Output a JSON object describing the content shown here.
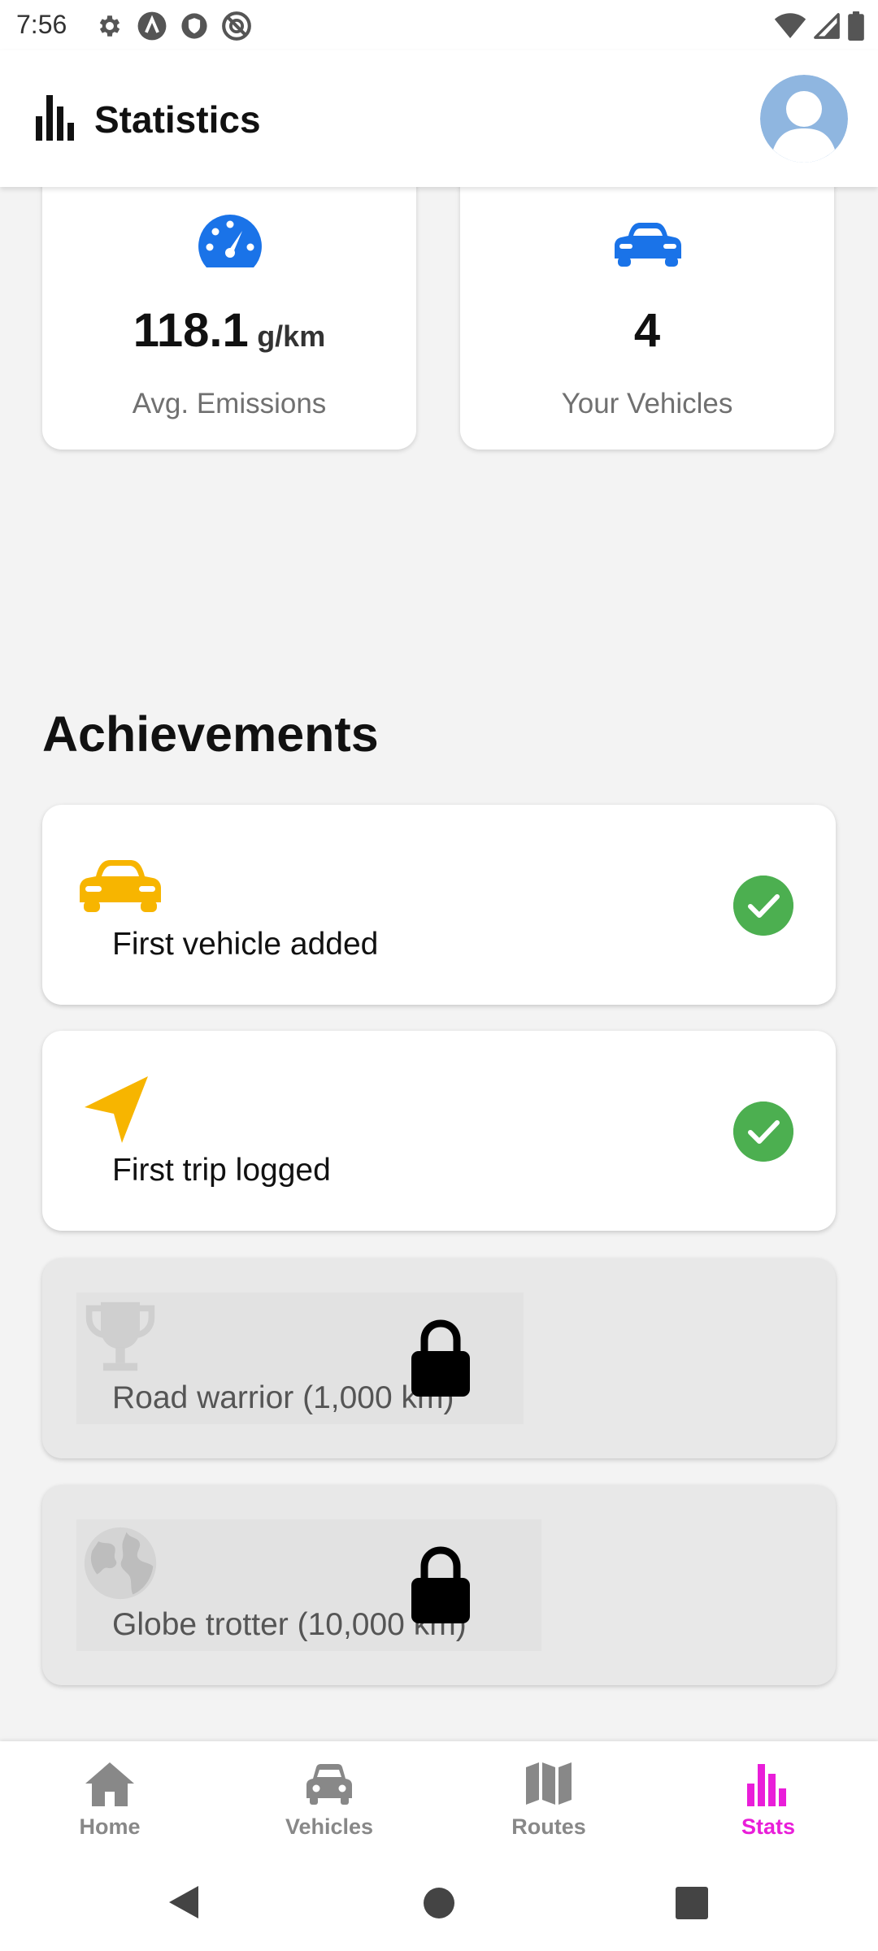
{
  "status_bar": {
    "time": "7:56"
  },
  "app_bar": {
    "title": "Statistics"
  },
  "stats": [
    {
      "value": "118.1",
      "unit": "g/km",
      "label": "Avg. Emissions",
      "icon": "speedometer-icon",
      "color": "#1a73e8"
    },
    {
      "value": "4",
      "label": "Your Vehicles",
      "icon": "car-icon",
      "color": "#1a73e8"
    }
  ],
  "achievements": {
    "title": "Achievements",
    "items": [
      {
        "label": "First vehicle added",
        "icon": "car-icon",
        "status": "completed"
      },
      {
        "label": "First trip logged",
        "icon": "navigation-arrow-icon",
        "status": "completed"
      },
      {
        "label": "Road warrior (1,000 km)",
        "icon": "trophy-icon",
        "status": "locked"
      },
      {
        "label": "Globe trotter (10,000 km)",
        "icon": "globe-icon",
        "status": "locked"
      }
    ]
  },
  "bottom_nav": {
    "items": [
      {
        "label": "Home",
        "icon": "home-icon"
      },
      {
        "label": "Vehicles",
        "icon": "car-icon"
      },
      {
        "label": "Routes",
        "icon": "map-icon"
      },
      {
        "label": "Stats",
        "icon": "bar-chart-icon",
        "active": true
      }
    ]
  },
  "colors": {
    "accent": "#e91ed9",
    "stat_icon": "#1a73e8",
    "achievement_icon": "#f7b500",
    "success": "#4caf50"
  }
}
